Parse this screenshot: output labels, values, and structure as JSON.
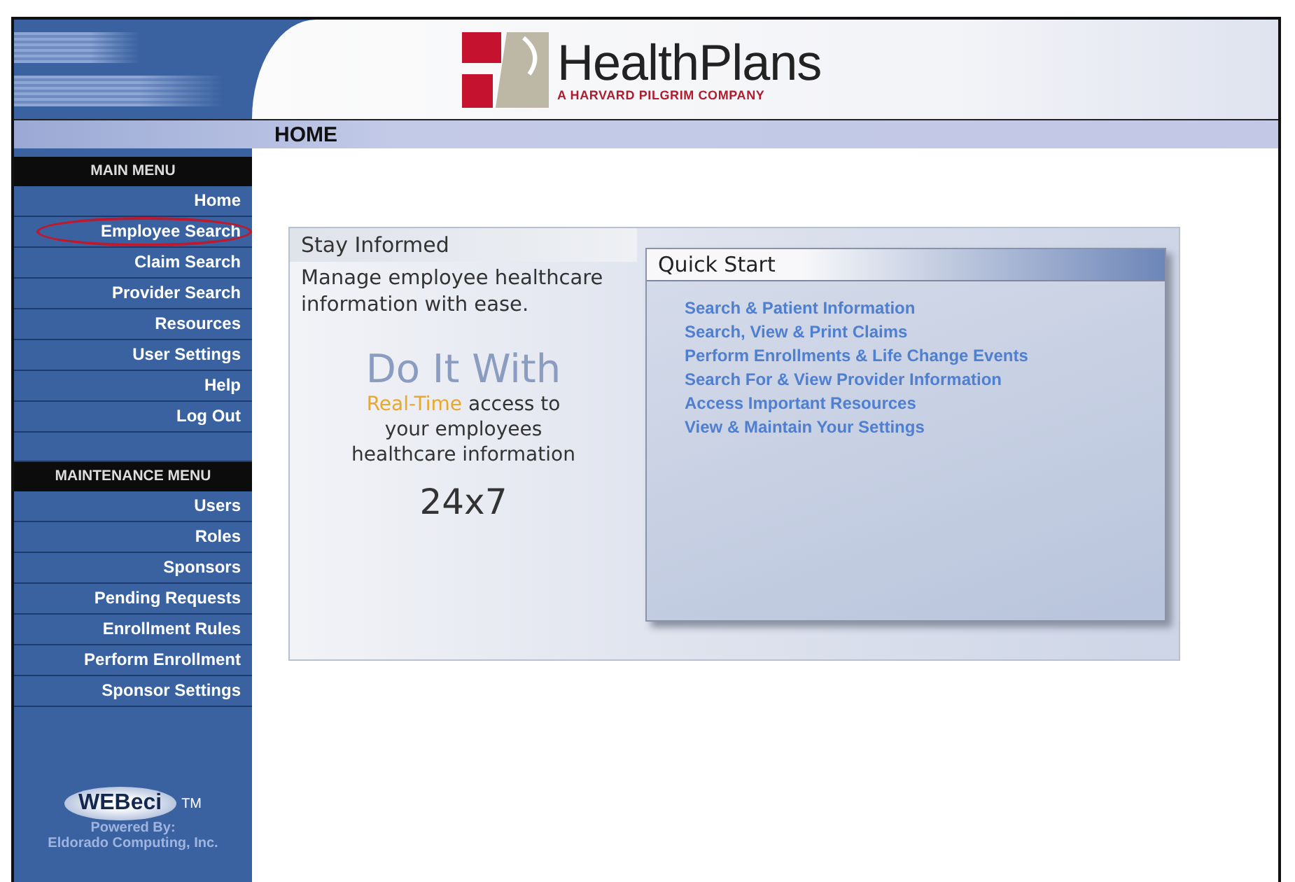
{
  "header": {
    "brand": "HealthPlans",
    "tagline": "A HARVARD PILGRIM COMPANY"
  },
  "page_title": "HOME",
  "sidebar": {
    "sections": [
      {
        "title": "MAIN MENU",
        "items": [
          {
            "label": "Home",
            "circled": false
          },
          {
            "label": "Employee Search",
            "circled": true
          },
          {
            "label": "Claim Search",
            "circled": false
          },
          {
            "label": "Provider Search",
            "circled": false
          },
          {
            "label": "Resources",
            "circled": false
          },
          {
            "label": "User Settings",
            "circled": false
          },
          {
            "label": "Help",
            "circled": false
          },
          {
            "label": "Log Out",
            "circled": false
          }
        ]
      },
      {
        "title": "MAINTENANCE MENU",
        "items": [
          {
            "label": "Users",
            "circled": false
          },
          {
            "label": "Roles",
            "circled": false
          },
          {
            "label": "Sponsors",
            "circled": false
          },
          {
            "label": "Pending Requests",
            "circled": false
          },
          {
            "label": "Enrollment Rules",
            "circled": false
          },
          {
            "label": "Perform Enrollment",
            "circled": false
          },
          {
            "label": "Sponsor Settings",
            "circled": false
          }
        ]
      }
    ],
    "footer": {
      "logo": "WEBeci",
      "trademark": "TM",
      "powered_by": "Powered By:",
      "company": "Eldorado Computing, Inc."
    }
  },
  "stay_informed": {
    "title": "Stay Informed",
    "intro": "Manage employee healthcare information with ease.",
    "headline": "Do It With",
    "highlight": "Real-Time",
    "line_rest": "access to",
    "line_2": "your employees",
    "line_3": "healthcare information",
    "availability": "24x7"
  },
  "quick_start": {
    "title": "Quick Start",
    "links": [
      "Search & Patient Information",
      "Search, View & Print Claims",
      "Perform Enrollments & Life Change Events",
      "Search For & View Provider Information",
      "Access Important Resources",
      "View & Maintain Your Settings"
    ]
  }
}
